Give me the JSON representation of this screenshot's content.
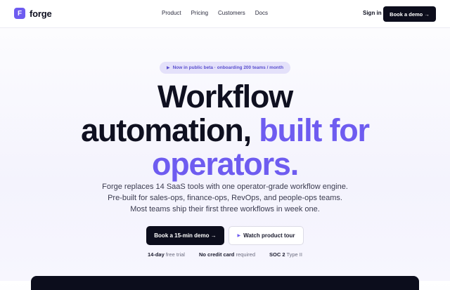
{
  "brand": {
    "logo_letter": "F",
    "name": "forge",
    "accent_color": "#6e5cf0"
  },
  "nav": {
    "links": [
      "Product",
      "Pricing",
      "Customers",
      "Docs"
    ],
    "sign_in": "Sign in",
    "cta": "Book a demo →"
  },
  "hero": {
    "badge": "Now in public beta · onboarding 200 teams / month",
    "headline_line1": "Workflow",
    "headline_line2_plain": "automation, ",
    "headline_line2_accent": "built for",
    "headline_line3_accent": "operators.",
    "subtext_line1": "Forge replaces 14 SaaS tools with one operator-grade workflow engine.",
    "subtext_line2": "Pre-built for sales-ops, finance-ops, RevOps, and people-ops teams.",
    "subtext_line3": "Most teams ship their first three workflows in week one.",
    "primary_cta": "Book a 15-min demo →",
    "secondary_cta": "Watch product tour"
  },
  "trust": [
    {
      "strong": "14-day",
      "rest": " free trial"
    },
    {
      "strong": "No credit card",
      "rest": " required"
    },
    {
      "strong": "SOC 2",
      "rest": " Type II"
    }
  ]
}
